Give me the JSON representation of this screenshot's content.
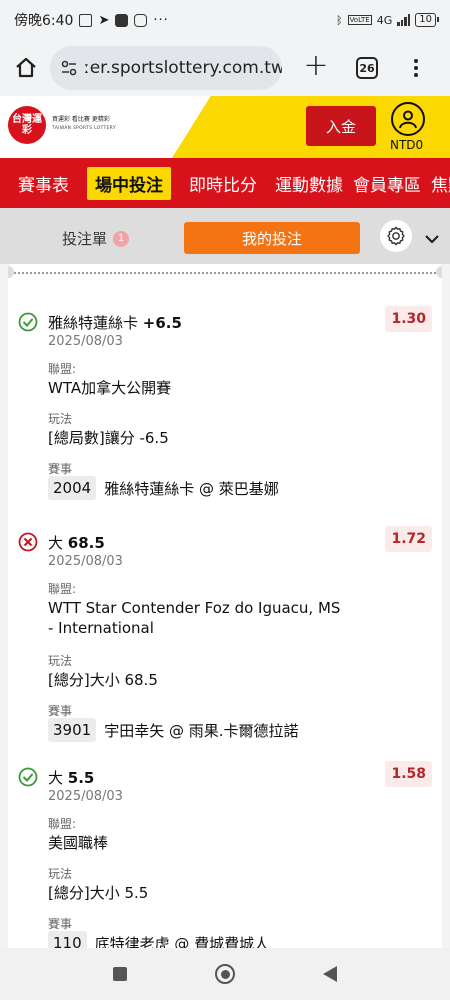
{
  "status_bar": {
    "time": "傍晚6:40",
    "battery": "10",
    "network": "4G"
  },
  "browser": {
    "url": "ːer.sportslottery.com.tw",
    "tab_count": "26"
  },
  "site": {
    "logo_text": "台灣運彩",
    "logo_tagline": "買運彩 看比賽 更精彩",
    "logo_subtitle": "TAIWAN SPORTS LOTTERY",
    "deposit_label": "入金",
    "balance": "NTD0"
  },
  "nav": {
    "items": [
      {
        "label": "賽事表"
      },
      {
        "label": "場中投注"
      },
      {
        "label": "即時比分"
      },
      {
        "label": "運動數據"
      },
      {
        "label": "會員專區"
      },
      {
        "label": "焦點"
      }
    ]
  },
  "slip": {
    "bet_slip_label": "投注單",
    "bet_slip_count": "1",
    "my_bets_label": "我的投注"
  },
  "labels": {
    "league": "聯盟:",
    "market": "玩法",
    "event": "賽事"
  },
  "bets": [
    {
      "status": "won",
      "selection_name": "雅絲特蓮絲卡",
      "selection_line": "+6.5",
      "odds": "1.30",
      "date": "2025/08/03",
      "league": "WTA加拿大公開賽",
      "market": "[總局數]讓分 -6.5",
      "event_no": "2004",
      "event_name": "雅絲特蓮絲卡 @ 萊巴基娜"
    },
    {
      "status": "lost",
      "selection_name": "大",
      "selection_line": "68.5",
      "odds": "1.72",
      "date": "2025/08/03",
      "league": "WTT Star Contender Foz do Iguacu, MS - International",
      "market": "[總分]大小 68.5",
      "event_no": "3901",
      "event_name": "宇田幸矢 @ 雨果.卡爾德拉諾"
    },
    {
      "status": "won",
      "selection_name": "大",
      "selection_line": "5.5",
      "odds": "1.58",
      "date": "2025/08/03",
      "league": "美國職棒",
      "market": "[總分]大小 5.5",
      "event_no": "110",
      "event_name": "底特律老虎 @ 費城費城人"
    }
  ],
  "colors": {
    "brand_red": "#d7121a",
    "brand_yellow": "#fbd900",
    "orange": "#f47414",
    "won_green": "#3a9a3a",
    "lost_red": "#c8151b"
  }
}
